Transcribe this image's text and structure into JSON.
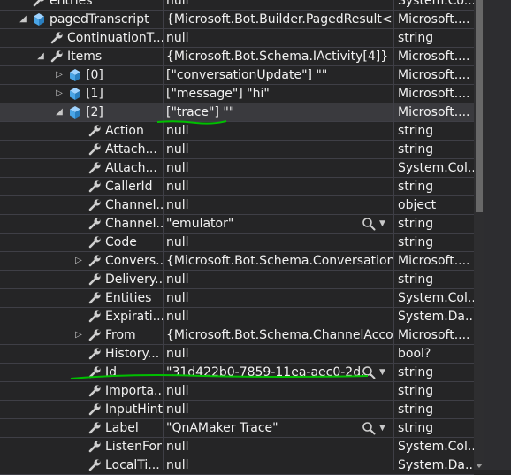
{
  "rows": [
    {
      "name": "entries",
      "value": "null",
      "type": "System.Co...",
      "indent": 56,
      "expander": "",
      "icon": "wrench"
    },
    {
      "name": "pagedTranscript",
      "value": "{Microsoft.Bot.Builder.PagedResult<...",
      "type": "Microsoft....",
      "indent": 56,
      "expander": "expanded",
      "icon": "cube"
    },
    {
      "name": "ContinuationT...",
      "value": "null",
      "type": "string",
      "indent": 76,
      "expander": "",
      "icon": "wrench"
    },
    {
      "name": "Items",
      "value": "{Microsoft.Bot.Schema.IActivity[4]}",
      "type": "Microsoft....",
      "indent": 76,
      "expander": "expanded",
      "icon": "wrench"
    },
    {
      "name": "[0]",
      "value": "[\"conversationUpdate\"] \"\"",
      "type": "Microsoft....",
      "indent": 97,
      "expander": "collapsed",
      "icon": "cube"
    },
    {
      "name": "[1]",
      "value": "[\"message\"] \"hi\"",
      "type": "Microsoft....",
      "indent": 97,
      "expander": "collapsed",
      "icon": "cube"
    },
    {
      "name": "[2]",
      "value": "[\"trace\"] \"\"",
      "type": "Microsoft....",
      "indent": 97,
      "expander": "expanded",
      "icon": "cube",
      "selected": true
    },
    {
      "name": "Action",
      "value": "null",
      "type": "string",
      "indent": 119,
      "expander": "",
      "icon": "wrench"
    },
    {
      "name": "Attach...",
      "value": "null",
      "type": "string",
      "indent": 119,
      "expander": "",
      "icon": "wrench"
    },
    {
      "name": "Attach...",
      "value": "null",
      "type": "System.Col...",
      "indent": 119,
      "expander": "",
      "icon": "wrench"
    },
    {
      "name": "CallerId",
      "value": "null",
      "type": "string",
      "indent": 119,
      "expander": "",
      "icon": "wrench"
    },
    {
      "name": "Channel...",
      "value": "null",
      "type": "object",
      "indent": 119,
      "expander": "",
      "icon": "wrench"
    },
    {
      "name": "Channel...",
      "value": "\"emulator\"",
      "type": "string",
      "indent": 119,
      "expander": "",
      "icon": "wrench",
      "visualizer": true
    },
    {
      "name": "Code",
      "value": "null",
      "type": "string",
      "indent": 119,
      "expander": "",
      "icon": "wrench"
    },
    {
      "name": "Convers...",
      "value": "{Microsoft.Bot.Schema.ConversationA...",
      "type": "Microsoft....",
      "indent": 119,
      "expander": "collapsed",
      "icon": "wrench"
    },
    {
      "name": "Delivery...",
      "value": "null",
      "type": "string",
      "indent": 119,
      "expander": "",
      "icon": "wrench"
    },
    {
      "name": "Entities",
      "value": "null",
      "type": "System.Col...",
      "indent": 119,
      "expander": "",
      "icon": "wrench"
    },
    {
      "name": "Expirati...",
      "value": "null",
      "type": "System.Da...",
      "indent": 119,
      "expander": "",
      "icon": "wrench"
    },
    {
      "name": "From",
      "value": "{Microsoft.Bot.Schema.ChannelAccou...",
      "type": "Microsoft....",
      "indent": 119,
      "expander": "collapsed",
      "icon": "wrench"
    },
    {
      "name": "History...",
      "value": "null",
      "type": "bool?",
      "indent": 119,
      "expander": "",
      "icon": "wrench"
    },
    {
      "name": "Id",
      "value": "\"31d422b0-7859-11ea-aec0-2d...",
      "type": "string",
      "indent": 119,
      "expander": "",
      "icon": "wrench",
      "visualizer": true
    },
    {
      "name": "Importa...",
      "value": "null",
      "type": "string",
      "indent": 119,
      "expander": "",
      "icon": "wrench"
    },
    {
      "name": "InputHint",
      "value": "null",
      "type": "string",
      "indent": 119,
      "expander": "",
      "icon": "wrench"
    },
    {
      "name": "Label",
      "value": "\"QnAMaker Trace\"",
      "type": "string",
      "indent": 119,
      "expander": "",
      "icon": "wrench",
      "visualizer": true
    },
    {
      "name": "ListenFor",
      "value": "null",
      "type": "System.Col...",
      "indent": 119,
      "expander": "",
      "icon": "wrench"
    },
    {
      "name": "LocalTi...",
      "value": "null",
      "type": "System.Da...",
      "indent": 119,
      "expander": "",
      "icon": "wrench"
    }
  ],
  "icons": {
    "wrench": "property-wrench-icon",
    "cube": "object-cube-icon",
    "visualizer": "magnifier-icon",
    "dropdown": "chevron-down-icon"
  },
  "colors": {
    "background": "#252526",
    "grid": "#3f3f46",
    "selected": "#3a3a3e",
    "cube": "#4aa5e6",
    "annotation": "#00c000"
  }
}
